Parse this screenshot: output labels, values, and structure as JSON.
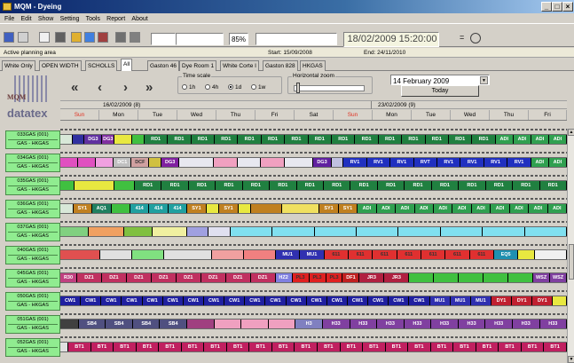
{
  "window": {
    "title": "MQM - Dyeing"
  },
  "menu": [
    "File",
    "Edit",
    "Show",
    "Setting",
    "Tools",
    "Report",
    "About"
  ],
  "toolbar": {
    "zoom": "85%",
    "datetime": "18/02/2009 15:20:00",
    "eq_label": "="
  },
  "info": {
    "area": "Active planning area",
    "start": "Start: 15/09/2008",
    "end": "End: 24/11/2010"
  },
  "tabs": [
    "White Only",
    "OPEN WIDTH",
    "SCHOLLS",
    "All",
    "Gaston 46",
    "Dye Room 1",
    "White Corte I",
    "Gaston 828",
    "HKGAS"
  ],
  "active_tab": "All",
  "logo": {
    "brand": "datatex",
    "product": "MQM"
  },
  "nav": {
    "first": "«",
    "prev": "‹",
    "next": "›",
    "last": "»"
  },
  "timescale": {
    "label": "Time scale",
    "options": [
      "1h",
      "4h",
      "1d",
      "1w"
    ],
    "selected": "1d"
  },
  "hzoom": {
    "label": "Horizontal zoom"
  },
  "datepicker": {
    "value": "14  February  2009",
    "today": "Today"
  },
  "weeks": [
    "16/02/2009 (8)",
    "23/02/2009 (9)"
  ],
  "days": [
    "Sun",
    "Mon",
    "Tue",
    "Wed",
    "Thu",
    "Fri",
    "Sat",
    "Sun",
    "Mon",
    "Tue",
    "Wed",
    "Thu",
    "Fri"
  ],
  "resources": [
    {
      "id": "033GAS (001)",
      "group": "GAS - HKGAS"
    },
    {
      "id": "034GAS (001)",
      "group": "GAS - HKGAS"
    },
    {
      "id": "035GAS (001)",
      "group": "GAS - HKGAS"
    },
    {
      "id": "036GAS (001)",
      "group": "GAS - HKGAS"
    },
    {
      "id": "037GAS (001)",
      "group": "GAS - HKGAS"
    },
    {
      "id": "040GAS (001)",
      "group": "GAS - HKGAS"
    },
    {
      "id": "045GAS (001)",
      "group": "GAS - HKGAS"
    },
    {
      "id": "050GAS (001)",
      "group": "GAS - HKGAS"
    },
    {
      "id": "051GAS (001)",
      "group": "GAS - HKGAS"
    },
    {
      "id": "052GAS (001)",
      "group": "GAS - HKGAS"
    }
  ],
  "lanes": [
    [
      [
        "",
        "#d8e8d8",
        2
      ],
      [
        "",
        "#3030a0",
        2
      ],
      [
        "DG3",
        "#6030a0",
        3
      ],
      [
        "DG3",
        "#8030a0",
        2
      ],
      [
        "",
        "#e8e840",
        3
      ],
      [
        "",
        "#40c040",
        2
      ],
      [
        "RD1",
        "#208040",
        4
      ],
      [
        "RD1",
        "#208040",
        4
      ],
      [
        "RD1",
        "#208040",
        4
      ],
      [
        "RD1",
        "#208040",
        4
      ],
      [
        "RD1",
        "#208040",
        4
      ],
      [
        "RD1",
        "#208040",
        4
      ],
      [
        "RD1",
        "#208040",
        4
      ],
      [
        "RD1",
        "#208040",
        4
      ],
      [
        "RD1",
        "#208040",
        4
      ],
      [
        "RD1",
        "#208040",
        4
      ],
      [
        "RD1",
        "#208040",
        4
      ],
      [
        "RD1",
        "#208040",
        4
      ],
      [
        "RD1",
        "#208040",
        4
      ],
      [
        "RD1",
        "#208040",
        4
      ],
      [
        "RD1",
        "#208040",
        4
      ],
      [
        "ADI",
        "#30a050",
        3
      ],
      [
        "ADI",
        "#30a050",
        3
      ],
      [
        "ADI",
        "#30a050",
        3
      ],
      [
        "ADI",
        "#30a050",
        3
      ]
    ],
    [
      [
        "",
        "#e050c0",
        3
      ],
      [
        "",
        "#e050c0",
        3
      ],
      [
        "",
        "#f0a0e0",
        3
      ],
      [
        "DC1",
        "#c0c0c0",
        3
      ],
      [
        "DCF",
        "#d0a0a0",
        3
      ],
      [
        "",
        "#d0c040",
        2
      ],
      [
        "DG3",
        "#8020a0",
        3
      ],
      [
        "",
        "#e8e8f0",
        6
      ],
      [
        "",
        "#f0a0c0",
        4
      ],
      [
        "",
        "#e8e8f0",
        4
      ],
      [
        "",
        "#f0a0c0",
        4
      ],
      [
        "",
        "#e8e8f0",
        5
      ],
      [
        "DG3",
        "#6020a0",
        3
      ],
      [
        "",
        "#c0c0e0",
        2
      ],
      [
        "RV1",
        "#2030c0",
        4
      ],
      [
        "RV1",
        "#2030c0",
        4
      ],
      [
        "RV1",
        "#2030c0",
        4
      ],
      [
        "RVT",
        "#2030c0",
        4
      ],
      [
        "RV1",
        "#2030c0",
        4
      ],
      [
        "RV1",
        "#2030c0",
        4
      ],
      [
        "RV1",
        "#2030c0",
        4
      ],
      [
        "RV1",
        "#2030c0",
        4
      ],
      [
        "ADI",
        "#30a050",
        3
      ],
      [
        "ADI",
        "#30a050",
        3
      ]
    ],
    [
      [
        "",
        "#40c040",
        2
      ],
      [
        "",
        "#e8e840",
        6
      ],
      [
        "",
        "#40c040",
        3
      ],
      [
        "RD1",
        "#208040",
        4
      ],
      [
        "RD1",
        "#208040",
        4
      ],
      [
        "RD1",
        "#208040",
        4
      ],
      [
        "RD1",
        "#208040",
        4
      ],
      [
        "RD1",
        "#208040",
        4
      ],
      [
        "RD1",
        "#208040",
        4
      ],
      [
        "RD1",
        "#208040",
        4
      ],
      [
        "RD1",
        "#208040",
        4
      ],
      [
        "RD1",
        "#208040",
        4
      ],
      [
        "RD1",
        "#208040",
        4
      ],
      [
        "RD1",
        "#208040",
        4
      ],
      [
        "RD1",
        "#208040",
        4
      ],
      [
        "RD1",
        "#208040",
        4
      ],
      [
        "RD1",
        "#208040",
        4
      ],
      [
        "RD1",
        "#208040",
        4
      ],
      [
        "RD1",
        "#208040",
        4
      ]
    ],
    [
      [
        "",
        "#d8e8d8",
        2
      ],
      [
        "SY1",
        "#c08020",
        3
      ],
      [
        "AQ1",
        "#208060",
        3
      ],
      [
        "",
        "#40c040",
        3
      ],
      [
        "414",
        "#20a0a0",
        3
      ],
      [
        "414",
        "#20a0a0",
        3
      ],
      [
        "414",
        "#20a0a0",
        3
      ],
      [
        "SY1",
        "#c08020",
        3
      ],
      [
        "",
        "#e8e840",
        2
      ],
      [
        "SY1",
        "#c08020",
        3
      ],
      [
        "",
        "#e8e840",
        2
      ],
      [
        "",
        "#c08020",
        5
      ],
      [
        "",
        "#f0e060",
        6
      ],
      [
        "SY1",
        "#c08020",
        3
      ],
      [
        "SY1",
        "#c08020",
        3
      ],
      [
        "ADI",
        "#30a050",
        3
      ],
      [
        "ADI",
        "#30a050",
        3
      ],
      [
        "ADI",
        "#30a050",
        3
      ],
      [
        "ADI",
        "#30a050",
        3
      ],
      [
        "ADI",
        "#30a050",
        3
      ],
      [
        "ADI",
        "#30a050",
        3
      ],
      [
        "ADI",
        "#30a050",
        3
      ],
      [
        "ADI",
        "#30a050",
        3
      ],
      [
        "ADI",
        "#30a050",
        3
      ],
      [
        "ADI",
        "#30a050",
        3
      ],
      [
        "ADI",
        "#30a050",
        3
      ]
    ],
    [
      [
        "",
        "#80d080",
        4
      ],
      [
        "",
        "#f0a060",
        5
      ],
      [
        "",
        "#80c040",
        4
      ],
      [
        "",
        "#f0f0a0",
        5
      ],
      [
        "",
        "#a0a0e0",
        3
      ],
      [
        "",
        "#e0e0f0",
        3
      ],
      [
        "",
        "#80e0f0",
        6
      ],
      [
        "",
        "#80e0f0",
        6
      ],
      [
        "",
        "#80e0f0",
        6
      ],
      [
        "",
        "#80e0f0",
        6
      ],
      [
        "",
        "#80e0f0",
        6
      ],
      [
        "",
        "#80e0f0",
        6
      ],
      [
        "",
        "#80e0f0",
        6
      ],
      [
        "",
        "#80e0f0",
        6
      ]
    ],
    [
      [
        "",
        "#e05050",
        5
      ],
      [
        "",
        "#e0e0e0",
        4
      ],
      [
        "",
        "#80e080",
        4
      ],
      [
        "",
        "#e0e0e0",
        6
      ],
      [
        "",
        "#f0a0a0",
        4
      ],
      [
        "",
        "#f08080",
        4
      ],
      [
        "MU1",
        "#3030b0",
        3
      ],
      [
        "MU1",
        "#3030b0",
        3
      ],
      [
        "611",
        "#e03030",
        3
      ],
      [
        "611",
        "#e03030",
        3
      ],
      [
        "611",
        "#e03030",
        3
      ],
      [
        "611",
        "#e03030",
        3
      ],
      [
        "611",
        "#e03030",
        3
      ],
      [
        "611",
        "#e03030",
        3
      ],
      [
        "611",
        "#e03030",
        3
      ],
      [
        "EQ5",
        "#2090b0",
        3
      ],
      [
        "",
        "#e8e840",
        2
      ],
      [
        "",
        "#f0f0f0",
        4
      ]
    ],
    [
      [
        "R30",
        "#c04080",
        2
      ],
      [
        "DZ1",
        "#c03060",
        3
      ],
      [
        "DZ1",
        "#c03060",
        3
      ],
      [
        "DZ1",
        "#c03060",
        3
      ],
      [
        "DZ1",
        "#c03060",
        3
      ],
      [
        "DZ1",
        "#c03060",
        3
      ],
      [
        "DZ1",
        "#c03060",
        3
      ],
      [
        "DZ1",
        "#c03060",
        3
      ],
      [
        "DZ1",
        "#c03060",
        3
      ],
      [
        "HZ2",
        "#8080e0",
        2
      ],
      [
        "PL3",
        "#e02020",
        2
      ],
      [
        "PL3",
        "#e02020",
        2
      ],
      [
        "PL3",
        "#e02020",
        2
      ],
      [
        "DF1",
        "#c02020",
        2
      ],
      [
        "JR3",
        "#b02040",
        3
      ],
      [
        "JR3",
        "#b02040",
        3
      ],
      [
        "",
        "#40c040",
        3
      ],
      [
        "",
        "#40c040",
        3
      ],
      [
        "",
        "#40c040",
        3
      ],
      [
        "",
        "#40c040",
        3
      ],
      [
        "",
        "#40c040",
        3
      ],
      [
        "WSZ",
        "#8040a0",
        2
      ],
      [
        "WSZ",
        "#8040a0",
        2
      ]
    ],
    [
      [
        "CW1",
        "#2020a0",
        3
      ],
      [
        "CW1",
        "#2020a0",
        3
      ],
      [
        "CW1",
        "#2020a0",
        3
      ],
      [
        "CW1",
        "#2020a0",
        3
      ],
      [
        "CW1",
        "#2020a0",
        3
      ],
      [
        "CW1",
        "#2020a0",
        3
      ],
      [
        "CW1",
        "#2020a0",
        3
      ],
      [
        "CW1",
        "#2020a0",
        3
      ],
      [
        "CW1",
        "#2020a0",
        3
      ],
      [
        "CW1",
        "#2020a0",
        3
      ],
      [
        "CW1",
        "#2020a0",
        3
      ],
      [
        "CW1",
        "#2020a0",
        3
      ],
      [
        "CW1",
        "#2020a0",
        3
      ],
      [
        "CW1",
        "#2020a0",
        3
      ],
      [
        "CW1",
        "#2020a0",
        3
      ],
      [
        "CW1",
        "#2020a0",
        3
      ],
      [
        "CW1",
        "#2020a0",
        3
      ],
      [
        "CW1",
        "#2020a0",
        3
      ],
      [
        "MU1",
        "#3030b0",
        3
      ],
      [
        "MU1",
        "#3030b0",
        3
      ],
      [
        "MU1",
        "#3030b0",
        3
      ],
      [
        "DY1",
        "#c02030",
        3
      ],
      [
        "DY1",
        "#c02030",
        3
      ],
      [
        "DY1",
        "#c02030",
        3
      ],
      [
        "",
        "#e8e840",
        2
      ]
    ],
    [
      [
        "",
        "#404040",
        2
      ],
      [
        "SB4",
        "#505080",
        3
      ],
      [
        "SB4",
        "#505080",
        3
      ],
      [
        "SB4",
        "#505080",
        3
      ],
      [
        "SB4",
        "#505080",
        3
      ],
      [
        "",
        "#a04080",
        3
      ],
      [
        "",
        "#f0a0c0",
        3
      ],
      [
        "",
        "#f0a0c0",
        3
      ],
      [
        "",
        "#f0a0c0",
        3
      ],
      [
        "H3",
        "#8080c0",
        3
      ],
      [
        "H33",
        "#8040a0",
        3
      ],
      [
        "H33",
        "#8040a0",
        3
      ],
      [
        "H33",
        "#8040a0",
        3
      ],
      [
        "H33",
        "#8040a0",
        3
      ],
      [
        "H33",
        "#8040a0",
        3
      ],
      [
        "H33",
        "#8040a0",
        3
      ],
      [
        "H33",
        "#8040a0",
        3
      ],
      [
        "H33",
        "#8040a0",
        3
      ],
      [
        "H33",
        "#8040a0",
        3
      ]
    ],
    [
      [
        "",
        "#e0e0e0",
        1
      ],
      [
        "BT1",
        "#c02060",
        3
      ],
      [
        "BT1",
        "#c02060",
        3
      ],
      [
        "BT1",
        "#c02060",
        3
      ],
      [
        "BT1",
        "#c02060",
        3
      ],
      [
        "BT1",
        "#c02060",
        3
      ],
      [
        "BT1",
        "#c02060",
        3
      ],
      [
        "BT1",
        "#c02060",
        3
      ],
      [
        "BT1",
        "#c02060",
        3
      ],
      [
        "BT1",
        "#c02060",
        3
      ],
      [
        "BT1",
        "#c02060",
        3
      ],
      [
        "BT1",
        "#c02060",
        3
      ],
      [
        "BT1",
        "#c02060",
        3
      ],
      [
        "BT1",
        "#c02060",
        3
      ],
      [
        "BT1",
        "#c02060",
        3
      ],
      [
        "BT1",
        "#c02060",
        3
      ],
      [
        "BT1",
        "#c02060",
        3
      ],
      [
        "BT1",
        "#c02060",
        3
      ],
      [
        "BT1",
        "#c02060",
        3
      ],
      [
        "BT1",
        "#c02060",
        3
      ],
      [
        "BT1",
        "#c02060",
        3
      ],
      [
        "BT1",
        "#c02060",
        3
      ],
      [
        "BT1",
        "#c02060",
        3
      ]
    ]
  ]
}
